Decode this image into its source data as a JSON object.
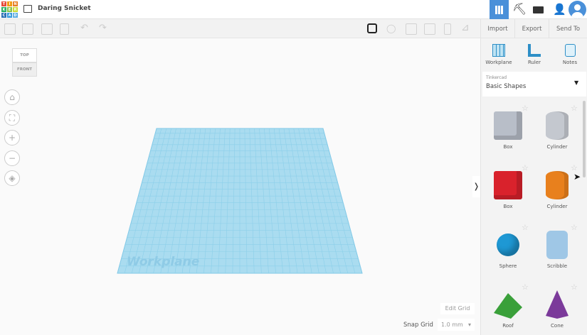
{
  "header": {
    "title": "Daring Snicket",
    "logo_letters": [
      "T",
      "I",
      "N",
      "K",
      "E",
      "R",
      "C",
      "A",
      "D"
    ]
  },
  "toolbar": {
    "import": "Import",
    "export": "Export",
    "send_to": "Send To"
  },
  "view_cube": {
    "top": "TOP",
    "front": "FRONT"
  },
  "workplane_label": "Workplane",
  "panel": {
    "tools": [
      {
        "label": "Workplane"
      },
      {
        "label": "Ruler"
      },
      {
        "label": "Notes"
      }
    ],
    "library_source": "Tinkercad",
    "library_name": "Basic Shapes",
    "shapes": [
      {
        "label": "Box",
        "color": "#b8bec8"
      },
      {
        "label": "Cylinder",
        "color": "#c4c8cf"
      },
      {
        "label": "Box",
        "color": "#d9222c"
      },
      {
        "label": "Cylinder",
        "color": "#e8801d"
      },
      {
        "label": "Sphere",
        "color": "#1e98d4"
      },
      {
        "label": "Scribble",
        "color": "#9fc7e6"
      },
      {
        "label": "Roof",
        "color": "#3aa03a"
      },
      {
        "label": "Cone",
        "color": "#7b3a9a"
      }
    ]
  },
  "bottom": {
    "edit_grid": "Edit Grid",
    "snap_grid_label": "Snap Grid",
    "snap_grid_value": "1.0 mm"
  },
  "colors": {
    "accent": "#4a90d9",
    "workplane": "#a9dcf0"
  }
}
